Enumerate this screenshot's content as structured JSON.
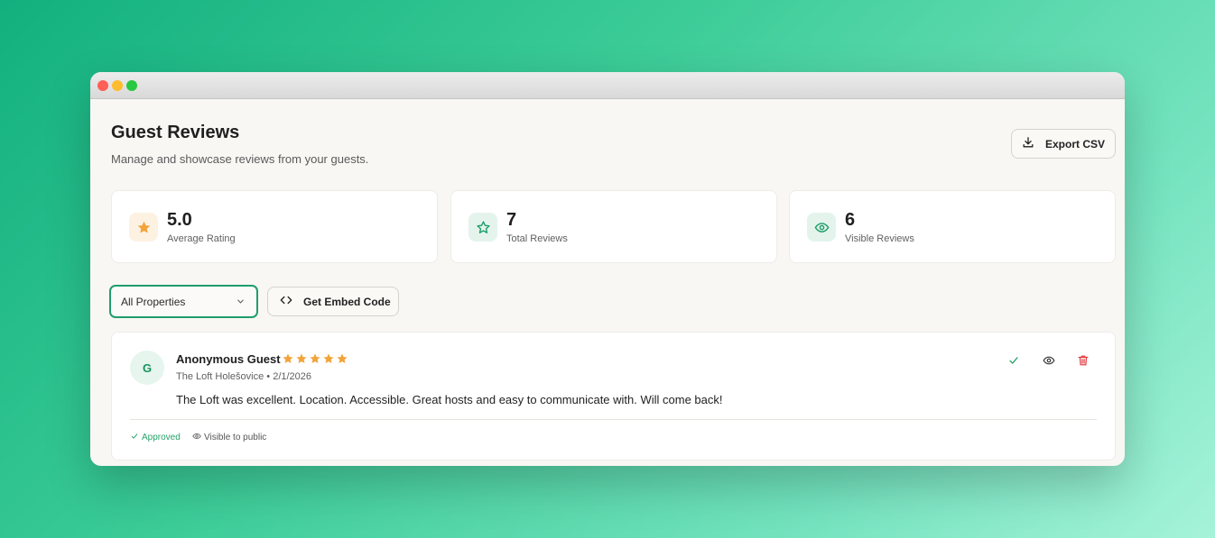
{
  "header": {
    "title": "Guest Reviews",
    "subtitle": "Manage and showcase reviews from your guests.",
    "export_label": "Export CSV"
  },
  "stats": [
    {
      "value": "5.0",
      "label": "Average Rating",
      "icon": "star-filled-icon",
      "color": "#f2a33a"
    },
    {
      "value": "7",
      "label": "Total Reviews",
      "icon": "star-outline-icon",
      "color": "#1f9e6b"
    },
    {
      "value": "6",
      "label": "Visible Reviews",
      "icon": "eye-icon",
      "color": "#1f9e6b"
    }
  ],
  "toolbar": {
    "property_select": "All Properties",
    "embed_label": "Get Embed Code"
  },
  "reviews": [
    {
      "avatar_initial": "G",
      "name": "Anonymous Guest",
      "rating": 5,
      "property": "The Loft Holešovice",
      "date": "2/1/2026",
      "text": "The Loft was excellent. Location. Accessible. Great hosts and easy to communicate with. Will come back!",
      "status": "Approved",
      "visibility": "Visible to public"
    }
  ],
  "colors": {
    "accent": "#1f9e6b",
    "star": "#f2a33a",
    "delete": "#e0393e"
  }
}
